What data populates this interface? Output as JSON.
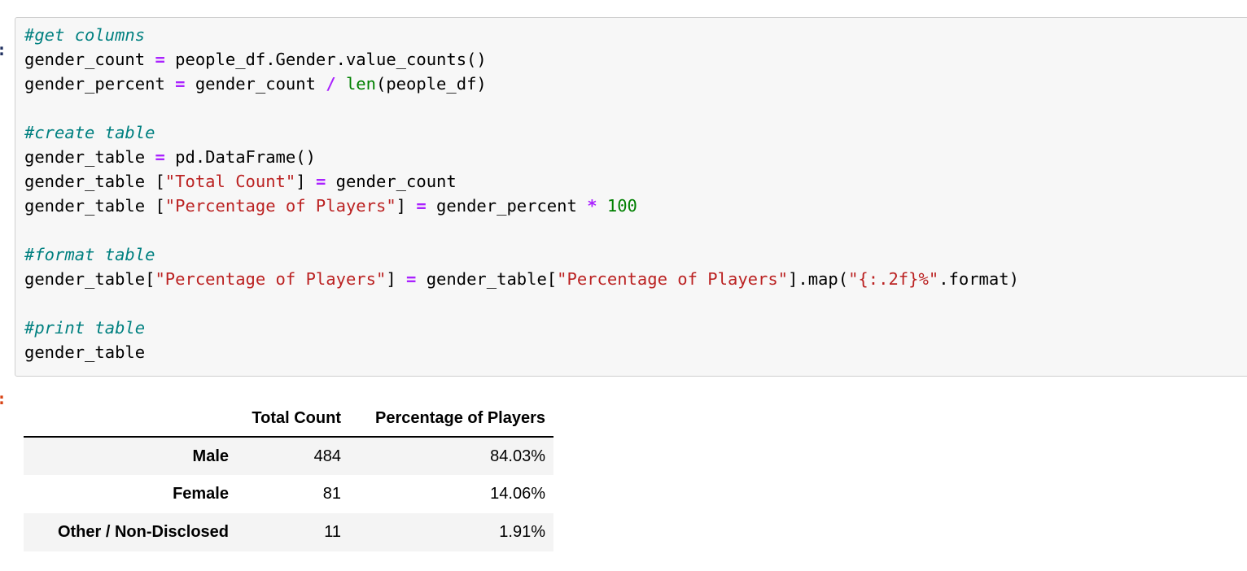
{
  "notebook": {
    "input_prompt": ":",
    "output_prompt": ":",
    "code_lines": [
      [
        {
          "t": "comment",
          "s": "#get columns"
        }
      ],
      [
        {
          "t": "plain",
          "s": "gender_count "
        },
        {
          "t": "op",
          "s": "="
        },
        {
          "t": "plain",
          "s": " people_df.Gender.value_counts()"
        }
      ],
      [
        {
          "t": "plain",
          "s": "gender_percent "
        },
        {
          "t": "op",
          "s": "="
        },
        {
          "t": "plain",
          "s": " gender_count "
        },
        {
          "t": "op",
          "s": "/"
        },
        {
          "t": "plain",
          "s": " "
        },
        {
          "t": "builtin",
          "s": "len"
        },
        {
          "t": "plain",
          "s": "(people_df)"
        }
      ],
      [
        {
          "t": "plain",
          "s": ""
        }
      ],
      [
        {
          "t": "comment",
          "s": "#create table"
        }
      ],
      [
        {
          "t": "plain",
          "s": "gender_table "
        },
        {
          "t": "op",
          "s": "="
        },
        {
          "t": "plain",
          "s": " pd.DataFrame()"
        }
      ],
      [
        {
          "t": "plain",
          "s": "gender_table ["
        },
        {
          "t": "str",
          "s": "\"Total Count\""
        },
        {
          "t": "plain",
          "s": "] "
        },
        {
          "t": "op",
          "s": "="
        },
        {
          "t": "plain",
          "s": " gender_count"
        }
      ],
      [
        {
          "t": "plain",
          "s": "gender_table ["
        },
        {
          "t": "str",
          "s": "\"Percentage of Players\""
        },
        {
          "t": "plain",
          "s": "] "
        },
        {
          "t": "op",
          "s": "="
        },
        {
          "t": "plain",
          "s": " gender_percent "
        },
        {
          "t": "op",
          "s": "*"
        },
        {
          "t": "plain",
          "s": " "
        },
        {
          "t": "num",
          "s": "100"
        }
      ],
      [
        {
          "t": "plain",
          "s": ""
        }
      ],
      [
        {
          "t": "comment",
          "s": "#format table"
        }
      ],
      [
        {
          "t": "plain",
          "s": "gender_table["
        },
        {
          "t": "str",
          "s": "\"Percentage of Players\""
        },
        {
          "t": "plain",
          "s": "] "
        },
        {
          "t": "op",
          "s": "="
        },
        {
          "t": "plain",
          "s": " gender_table["
        },
        {
          "t": "str",
          "s": "\"Percentage of Players\""
        },
        {
          "t": "plain",
          "s": "].map("
        },
        {
          "t": "str",
          "s": "\"{:.2f}%\""
        },
        {
          "t": "plain",
          "s": ".format)"
        }
      ],
      [
        {
          "t": "plain",
          "s": ""
        }
      ],
      [
        {
          "t": "comment",
          "s": "#print table"
        }
      ],
      [
        {
          "t": "plain",
          "s": "gender_table"
        }
      ]
    ],
    "output_table": {
      "index_header": "",
      "columns": [
        "Total Count",
        "Percentage of Players"
      ],
      "rows": [
        {
          "index": "Male",
          "total_count": "484",
          "percentage_of_players": "84.03%"
        },
        {
          "index": "Female",
          "total_count": "81",
          "percentage_of_players": "14.06%"
        },
        {
          "index": "Other / Non-Disclosed",
          "total_count": "11",
          "percentage_of_players": "1.91%"
        }
      ]
    }
  },
  "colors": {
    "cell_background": "#f7f7f7",
    "cell_border": "#cfcfcf",
    "comment": "#008080",
    "string": "#bb2222",
    "operator": "#aa22ff",
    "number": "#008000",
    "builtin": "#008000",
    "in_prompt": "#203060",
    "out_prompt": "#d84315",
    "table_stripe": "#f4f4f4"
  }
}
